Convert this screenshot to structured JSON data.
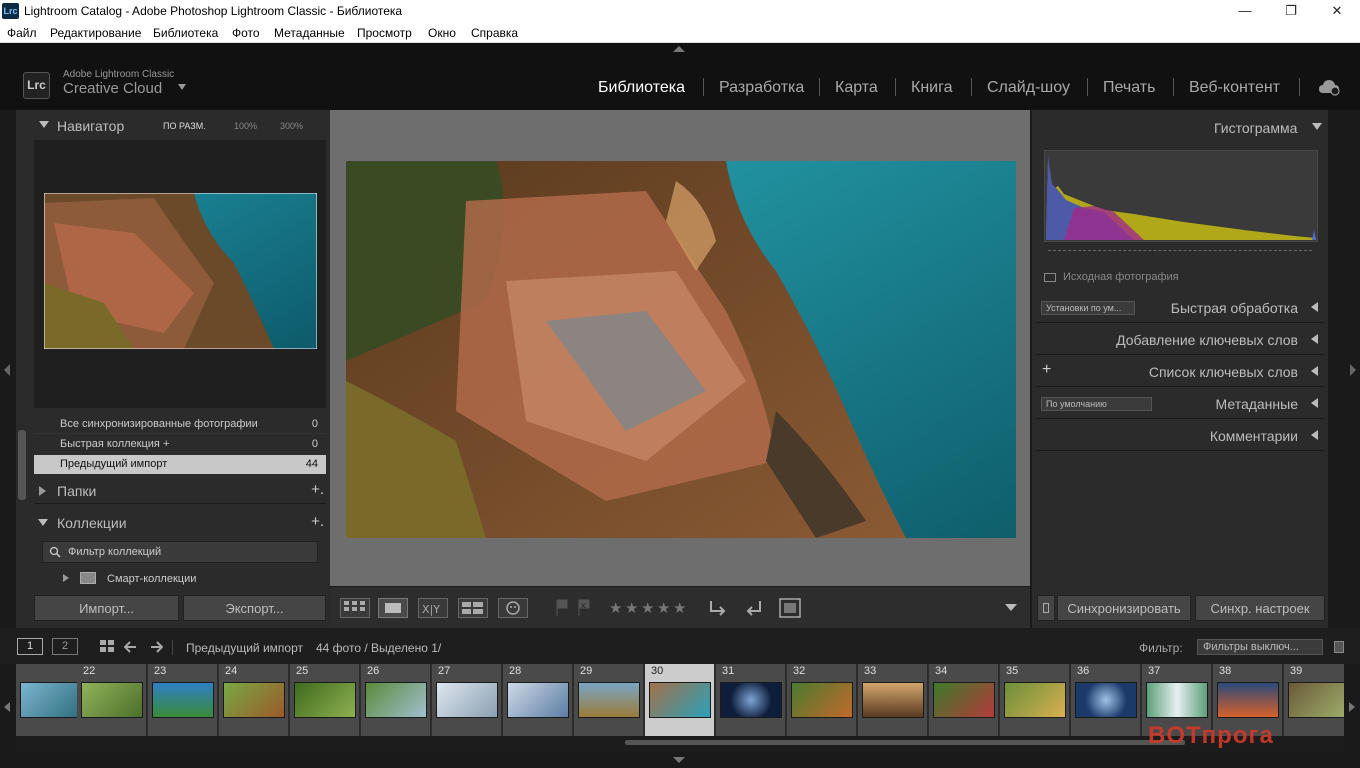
{
  "window": {
    "title": "Lightroom Catalog - Adobe Photoshop Lightroom Classic - Библиотека",
    "logo": "Lrc",
    "minimize_icon": "—",
    "restore_icon": "❐",
    "close_icon": "✕"
  },
  "menu": [
    "Файл",
    "Редактирование",
    "Библиотека",
    "Фото",
    "Метаданные",
    "Просмотр",
    "Окно",
    "Справка"
  ],
  "identity": {
    "badge": "Lrc",
    "small": "Adobe Lightroom Classic",
    "large": "Creative Cloud"
  },
  "modules": [
    "Библиотека",
    "Разработка",
    "Карта",
    "Книга",
    "Слайд-шоу",
    "Печать",
    "Веб-контент"
  ],
  "active_module": "Библиотека",
  "navigator": {
    "title": "Навигатор",
    "zoom_fit": "ПО РАЗМ.",
    "zoom_100": "100%",
    "zoom_300": "300%"
  },
  "catalog_items": [
    {
      "label": "Все синхронизированные фотографии",
      "count": "0"
    },
    {
      "label": "Быстрая коллекция  +",
      "count": "0"
    },
    {
      "label": "Предыдущий импорт",
      "count": "44"
    }
  ],
  "folders": {
    "title": "Папки",
    "add": "+."
  },
  "collections": {
    "title": "Коллекции",
    "add": "+.",
    "filter_placeholder": "Фильтр коллекций",
    "smart": "Смарт-коллекции"
  },
  "left_buttons": {
    "import": "Импорт...",
    "export": "Экспорт..."
  },
  "right": {
    "histogram": "Гистограмма",
    "original_photo": "Исходная фотография",
    "quick_develop": "Быстрая обработка",
    "quick_preset": "Установки по ум...",
    "keywording": "Добавление ключевых слов",
    "keyword_list": "Список ключевых слов",
    "keyword_plus": "+",
    "metadata": "Метаданные",
    "metadata_preset": "По умолчанию",
    "comments": "Комментарии",
    "sync": "Синхронизировать",
    "sync_settings": "Синхр. настроек"
  },
  "filmstrip_header": {
    "page1": "1",
    "page2": "2",
    "source": "Предыдущий импорт",
    "count": "44 фото /",
    "selected": "Выделено 1/",
    "filter_label": "Фильтр:",
    "filter_value": "Фильтры выключ..."
  },
  "filmstrip": [
    {
      "n": "",
      "c1": "#7ab6d0",
      "c2": "#2f6d7e"
    },
    {
      "n": "22",
      "c1": "#8fb35a",
      "c2": "#4c6f2b"
    },
    {
      "n": "23",
      "c1": "#2f7fc4",
      "c2": "#3a8a3a"
    },
    {
      "n": "24",
      "c1": "#77a843",
      "c2": "#9c5a2a"
    },
    {
      "n": "25",
      "c1": "#3f6b1f",
      "c2": "#8db04f"
    },
    {
      "n": "26",
      "c1": "#5a8a3a",
      "c2": "#a0c0d0"
    },
    {
      "n": "27",
      "c1": "#dfe6ee",
      "c2": "#8aa0b3"
    },
    {
      "n": "28",
      "c1": "#cfd9e6",
      "c2": "#5a7da5"
    },
    {
      "n": "29",
      "c1": "#7aa6c4",
      "c2": "#9a7b3a"
    },
    {
      "n": "30",
      "c1": "#2aa0b8",
      "c2": "#a3714a"
    },
    {
      "n": "31",
      "c1": "#0d1d3a",
      "c2": "#7fa4d6"
    },
    {
      "n": "32",
      "c1": "#4a7a2f",
      "c2": "#c26a2a"
    },
    {
      "n": "33",
      "c1": "#d2a56a",
      "c2": "#5a3a22"
    },
    {
      "n": "34",
      "c1": "#3c7a2a",
      "c2": "#b33a3a"
    },
    {
      "n": "35",
      "c1": "#6a8f3a",
      "c2": "#d8b050"
    },
    {
      "n": "36",
      "c1": "#1a3a6a",
      "c2": "#9fc3e6"
    },
    {
      "n": "37",
      "c1": "#5da07a",
      "c2": "#e6eef0"
    },
    {
      "n": "38",
      "c1": "#d8602a",
      "c2": "#2a4a7a"
    },
    {
      "n": "39",
      "c1": "#6a5a3a",
      "c2": "#9fb06a"
    }
  ],
  "colors": {
    "accent_active": "#ffffff",
    "panel": "#2b2b2b",
    "center_bg": "#6e6e6e"
  },
  "watermark": "BOTпрога"
}
